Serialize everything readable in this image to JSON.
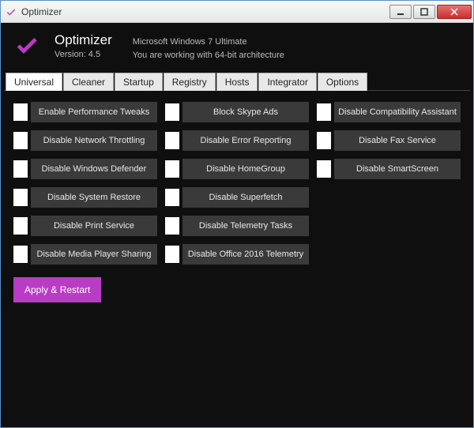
{
  "window": {
    "title": "Optimizer"
  },
  "header": {
    "title": "Optimizer",
    "version": "Version: 4.5",
    "os": "Microsoft Windows 7 Ultimate",
    "arch": "You are working with 64-bit architecture"
  },
  "tabs": {
    "items": [
      {
        "label": "Universal"
      },
      {
        "label": "Cleaner"
      },
      {
        "label": "Startup"
      },
      {
        "label": "Registry"
      },
      {
        "label": "Hosts"
      },
      {
        "label": "Integrator"
      },
      {
        "label": "Options"
      }
    ],
    "activeIndex": 0
  },
  "options": {
    "col1": [
      "Enable Performance Tweaks",
      "Disable Network Throttling",
      "Disable Windows Defender",
      "Disable System Restore",
      "Disable Print Service",
      "Disable Media Player Sharing"
    ],
    "col2": [
      "Block Skype Ads",
      "Disable Error Reporting",
      "Disable HomeGroup",
      "Disable Superfetch",
      "Disable Telemetry Tasks",
      "Disable Office 2016 Telemetry"
    ],
    "col3": [
      "Disable Compatibility Assistant",
      "Disable Fax Service",
      "Disable SmartScreen"
    ]
  },
  "buttons": {
    "apply": "Apply & Restart"
  },
  "colors": {
    "accent": "#b93cc4"
  }
}
